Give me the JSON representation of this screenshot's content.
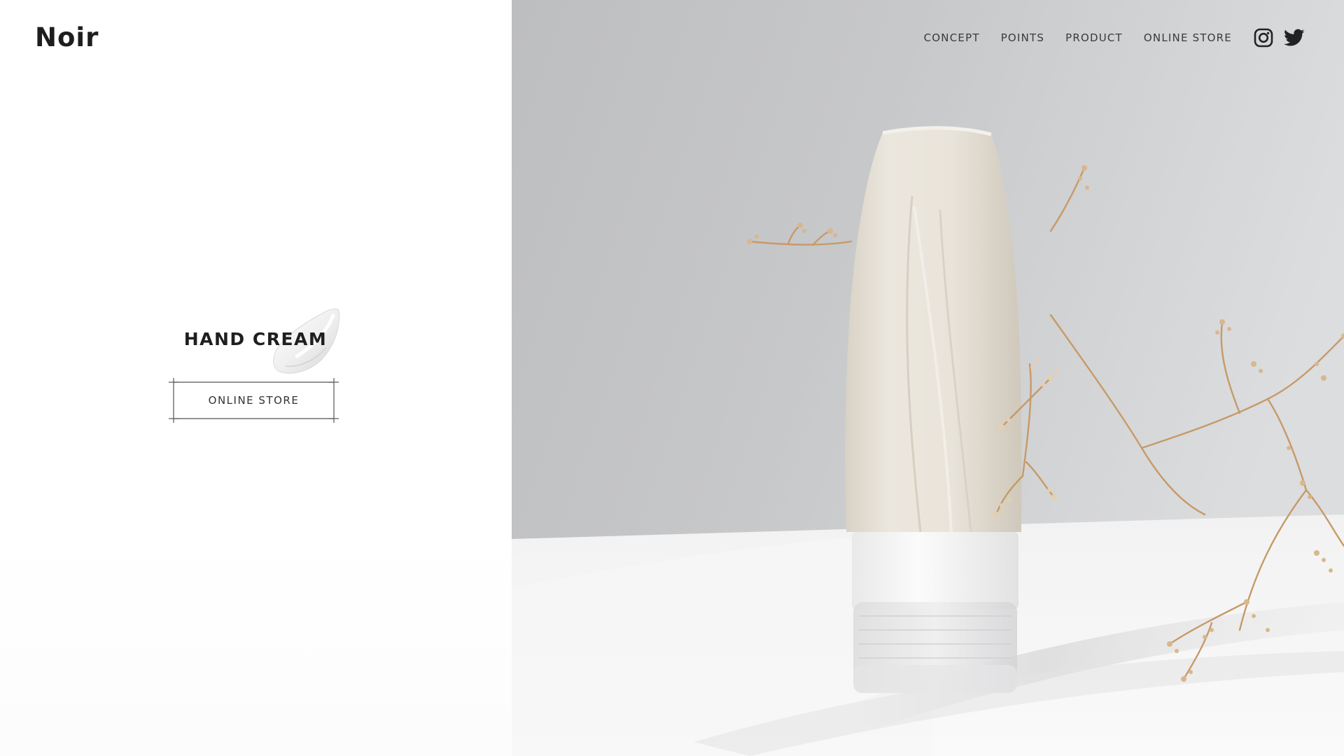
{
  "brand": {
    "logo_text": "Noir"
  },
  "nav": {
    "links": [
      {
        "label": "CONCEPT"
      },
      {
        "label": "POINTS"
      },
      {
        "label": "PRODUCT"
      },
      {
        "label": "ONLINE STORE"
      }
    ],
    "social": [
      {
        "icon": "instagram-icon"
      },
      {
        "icon": "twitter-icon"
      }
    ]
  },
  "hero": {
    "product_name": "HAND CREAM",
    "cta_label": "ONLINE STORE"
  },
  "colors": {
    "text_dark": "#1e1e1e",
    "background_left": "#ffffff",
    "wall_grey": "#c4c5c6",
    "tube_cream": "#eae5dc",
    "branch_gold": "#c9a173"
  }
}
